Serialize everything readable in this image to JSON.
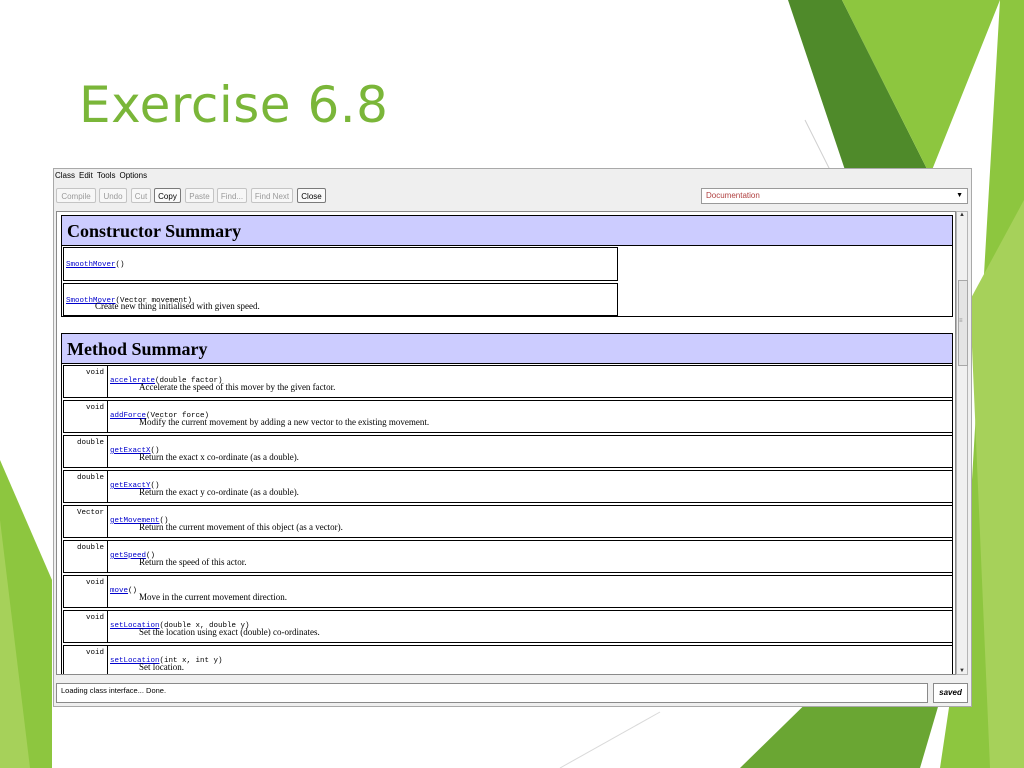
{
  "slide": {
    "title": "Exercise 6.8"
  },
  "colors": {
    "accent_green": "#7ab639",
    "summary_header": "#ccccff",
    "link": "#0000cc"
  },
  "menu": [
    "Class",
    "Edit",
    "Tools",
    "Options"
  ],
  "toolbar": {
    "buttons": [
      {
        "label": "Compile",
        "enabled": false
      },
      {
        "label": "Undo",
        "enabled": false
      },
      {
        "label": "Cut",
        "enabled": false
      },
      {
        "label": "Copy",
        "enabled": true
      },
      {
        "label": "Paste",
        "enabled": false
      },
      {
        "label": "Find...",
        "enabled": false
      },
      {
        "label": "Find Next",
        "enabled": false
      },
      {
        "label": "Close",
        "enabled": true
      }
    ],
    "view_select": "Documentation"
  },
  "constructor_summary": {
    "title": "Constructor Summary",
    "rows": [
      {
        "name": "SmoothMover",
        "params": "()",
        "desc": ""
      },
      {
        "name": "SmoothMover",
        "params": "(Vector movement)",
        "desc": "Create new thing initialised with given speed."
      }
    ]
  },
  "method_summary": {
    "title": "Method Summary",
    "rows": [
      {
        "type": "void",
        "name": "accelerate",
        "params": "(double factor)",
        "desc": "Accelerate the speed of this mover by the given factor."
      },
      {
        "type": "void",
        "name": "addForce",
        "params": "(Vector force)",
        "desc": "Modify the current movement by adding a new vector to the existing movement."
      },
      {
        "type": "double",
        "name": "getExactX",
        "params": "()",
        "desc": "Return the exact x co-ordinate (as a double)."
      },
      {
        "type": "double",
        "name": "getExactY",
        "params": "()",
        "desc": "Return the exact y co-ordinate (as a double)."
      },
      {
        "type": "Vector",
        "name": "getMovement",
        "params": "()",
        "desc": "Return the current movement of this object (as a vector)."
      },
      {
        "type": "double",
        "name": "getSpeed",
        "params": "()",
        "desc": "Return the speed of this actor."
      },
      {
        "type": "void",
        "name": "move",
        "params": "()",
        "desc": "Move in the current movement direction."
      },
      {
        "type": "void",
        "name": "setLocation",
        "params": "(double x, double y)",
        "desc": "Set the location using exact (double) co-ordinates."
      },
      {
        "type": "void",
        "name": "setLocation",
        "params": "(int x, int y)",
        "desc": "Set location."
      }
    ]
  },
  "status": {
    "message": "Loading class interface... Done.",
    "saved": "saved"
  }
}
